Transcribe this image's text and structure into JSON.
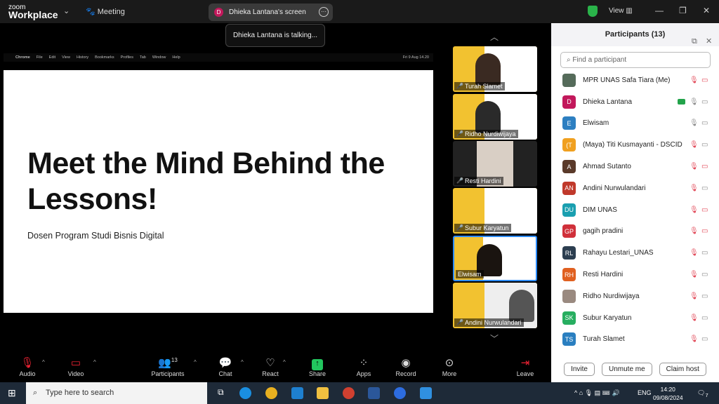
{
  "app": {
    "brand_small": "zoom",
    "brand": "Workplace",
    "menu": "Meeting",
    "share_owner_initial": "D",
    "share_label": "Dhieka Lantana's screen",
    "talking": "Dhieka Lantana is talking...",
    "view": "View"
  },
  "shared": {
    "menubar": [
      "Chrome",
      "File",
      "Edit",
      "View",
      "History",
      "Bookmarks",
      "Profiles",
      "Tab",
      "Window",
      "Help"
    ],
    "menubar_clock": "Fri 9 Aug  14.20",
    "title": "Meet the Mind Behind the Lessons!",
    "subtitle": "Dosen Program Studi Bisnis Digital"
  },
  "tiles": [
    {
      "name": "Turah Slamet",
      "muted": true
    },
    {
      "name": "Ridho Nurdiwijaya",
      "muted": true
    },
    {
      "name": "Resti Hardini",
      "muted": true
    },
    {
      "name": "Subur Karyatun",
      "muted": true
    },
    {
      "name": "Elwisam",
      "muted": false
    },
    {
      "name": "Andini Nurwulandari",
      "muted": true
    }
  ],
  "panel": {
    "title": "Participants (13)",
    "search_placeholder": "Find a participant",
    "participants": [
      {
        "initials": "",
        "name": "MPR UNAS Safa Tiara (Me)",
        "color": "#556b5a",
        "mic": "muted",
        "video": "off"
      },
      {
        "initials": "D",
        "name": "Dhieka Lantana",
        "color": "#c2185b",
        "mic": "on",
        "video": "on",
        "sharing": true
      },
      {
        "initials": "E",
        "name": "Elwisam",
        "color": "#2d7fc1",
        "mic": "on",
        "video": "on"
      },
      {
        "initials": "(T",
        "name": "(Maya) Titi Kusmayanti - DSCID",
        "color": "#f0a020",
        "mic": "muted",
        "video": "on"
      },
      {
        "initials": "A",
        "name": "Ahmad Sutanto",
        "color": "#5a3a2a",
        "mic": "muted",
        "video": "off"
      },
      {
        "initials": "AN",
        "name": "Andini Nurwulandari",
        "color": "#c0392b",
        "mic": "muted",
        "video": "on"
      },
      {
        "initials": "DU",
        "name": "DIM UNAS",
        "color": "#1a9fb0",
        "mic": "muted",
        "video": "off"
      },
      {
        "initials": "GP",
        "name": "gagih pradini",
        "color": "#d0303a",
        "mic": "muted",
        "video": "off"
      },
      {
        "initials": "RL",
        "name": "Rahayu Lestari_UNAS",
        "color": "#2c3e50",
        "mic": "muted",
        "video": "on"
      },
      {
        "initials": "RH",
        "name": "Resti Hardini",
        "color": "#e06020",
        "mic": "muted",
        "video": "on"
      },
      {
        "initials": "",
        "name": "Ridho Nurdiwijaya",
        "color": "#9a8a80",
        "mic": "muted",
        "video": "on"
      },
      {
        "initials": "SK",
        "name": "Subur Karyatun",
        "color": "#27ae60",
        "mic": "muted",
        "video": "on"
      },
      {
        "initials": "TS",
        "name": "Turah Slamet",
        "color": "#2a7fc0",
        "mic": "muted",
        "video": "on"
      }
    ],
    "buttons": {
      "invite": "Invite",
      "unmute": "Unmute me",
      "claim": "Claim host"
    }
  },
  "toolbar": {
    "audio": "Audio",
    "video": "Video",
    "participants": "Participants",
    "participants_count": "13",
    "chat": "Chat",
    "react": "React",
    "share": "Share",
    "apps": "Apps",
    "record": "Record",
    "more": "More",
    "leave": "Leave"
  },
  "taskbar": {
    "search_placeholder": "Type here to search",
    "lang": "ENG",
    "time": "14:20",
    "date": "09/08/2024",
    "notifications": "7"
  }
}
